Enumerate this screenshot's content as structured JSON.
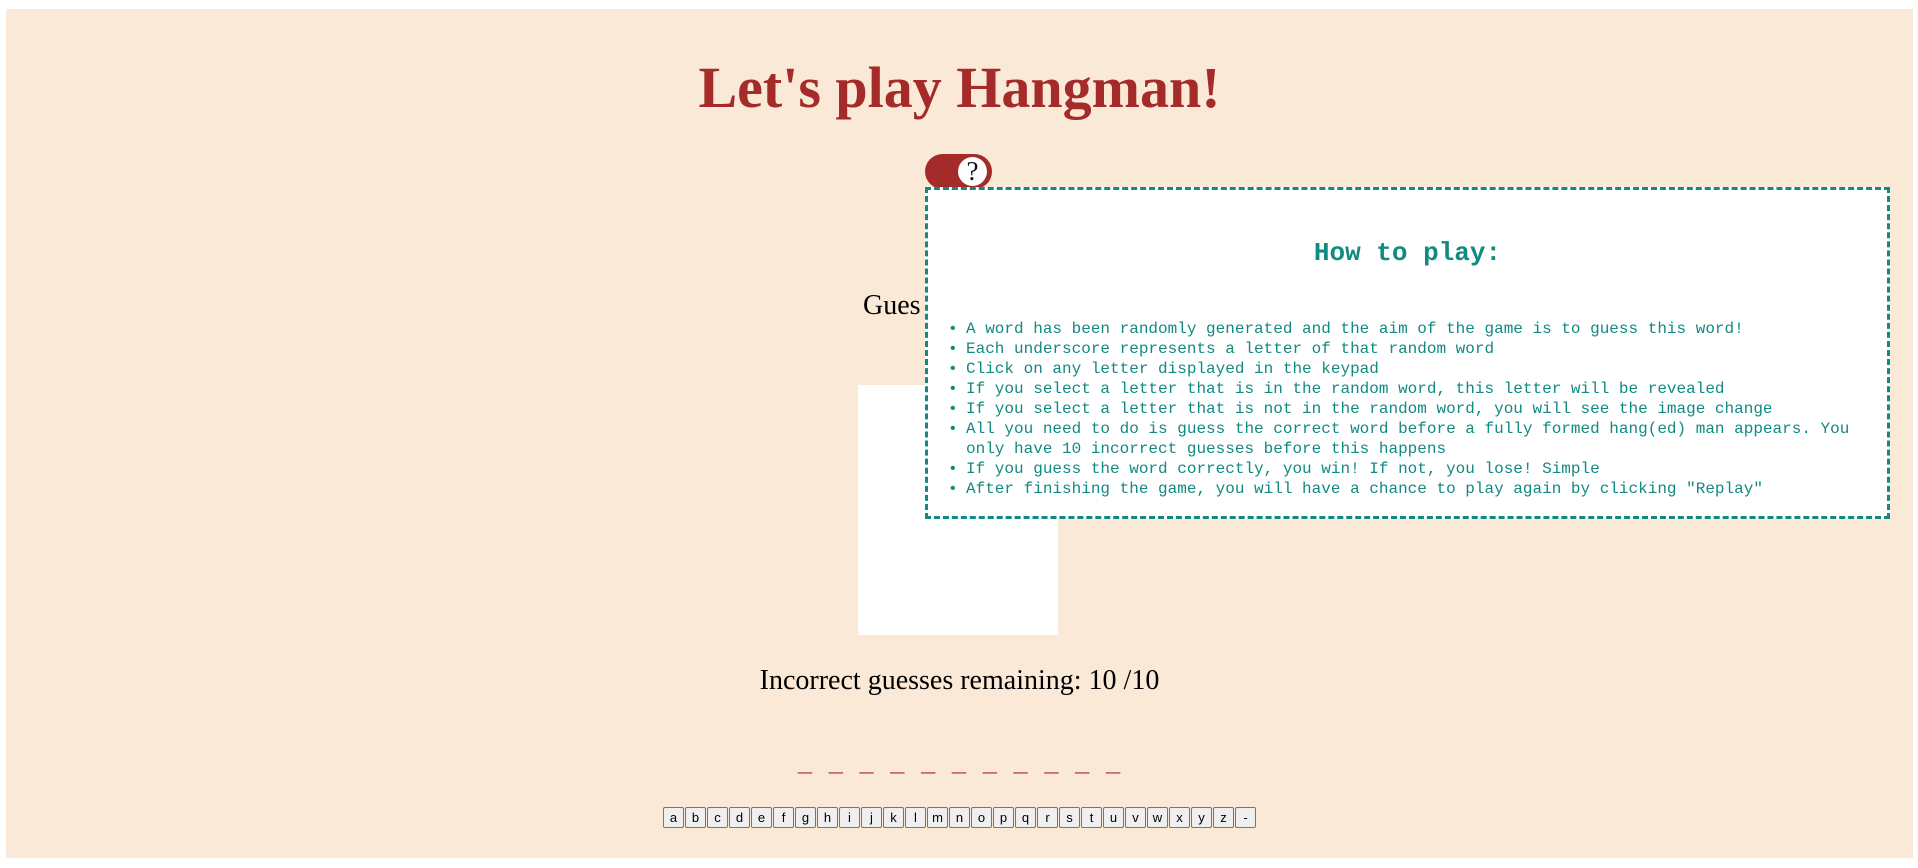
{
  "title": "Let's play Hangman!",
  "help_toggle": {
    "label": "?"
  },
  "guess_label": "Gues",
  "incorrect_guesses": {
    "label": "Incorrect guesses remaining:",
    "remaining": 10,
    "total": 10
  },
  "word": {
    "letter_count": 11,
    "blank_char": "_"
  },
  "keypad": {
    "keys": [
      "a",
      "b",
      "c",
      "d",
      "e",
      "f",
      "g",
      "h",
      "i",
      "j",
      "k",
      "l",
      "m",
      "n",
      "o",
      "p",
      "q",
      "r",
      "s",
      "t",
      "u",
      "v",
      "w",
      "x",
      "y",
      "z",
      "-"
    ]
  },
  "help": {
    "title": "How to play:",
    "items": [
      "A word has been randomly generated and the aim of the game is to guess this word!",
      "Each underscore represents a letter of that random word",
      "Click on any letter displayed in the keypad",
      "If you select a letter that is in the random word, this letter will be revealed",
      "If you select a letter that is not in the random word, you will see the image change",
      "All you need to do is guess the correct word before a fully formed hang(ed) man appears. You only have 10 incorrect guesses before this happens",
      "If you guess the word correctly, you win! If not, you lose! Simple",
      "After finishing the game, you will have a chance to play again by clicking \"Replay\""
    ]
  },
  "colors": {
    "page_background": "#f9e9d6",
    "accent": "#a52a2a",
    "help_accent": "#118a82"
  }
}
